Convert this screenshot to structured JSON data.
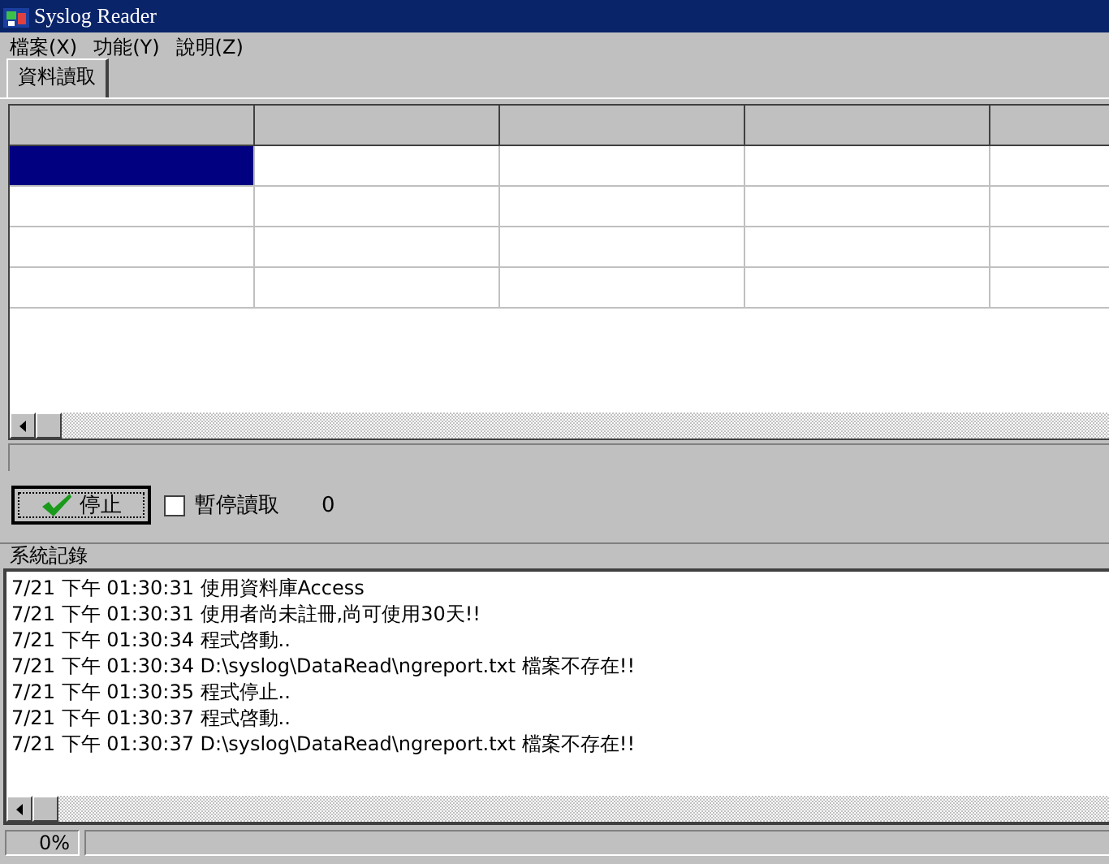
{
  "window": {
    "title": "Syslog Reader"
  },
  "menu": [
    "檔案(X)",
    "功能(Y)",
    "說明(Z)"
  ],
  "tabs": [
    {
      "label": "資料讀取",
      "selected": true
    }
  ],
  "grid": {
    "rows": [
      {
        "selected": true
      },
      {
        "selected": false
      },
      {
        "selected": false
      },
      {
        "selected": false
      }
    ]
  },
  "controls": {
    "stop_button": "停止",
    "pause": {
      "label": "暫停讀取",
      "checked": false
    },
    "count": "0"
  },
  "log": {
    "title": "系統記錄",
    "lines": [
      "7/21 下午 01:30:31 使用資料庫Access",
      "7/21 下午 01:30:31 使用者尚未註冊,尚可使用30天!!",
      "7/21 下午 01:30:34 程式啓動..",
      "7/21 下午 01:30:34 D:\\syslog\\DataRead\\ngreport.txt 檔案不存在!!",
      "7/21 下午 01:30:35 程式停止..",
      "7/21 下午 01:30:37 程式啓動..",
      "7/21 下午 01:30:37 D:\\syslog\\DataRead\\ngreport.txt 檔案不存在!!"
    ]
  },
  "status_bar": {
    "progress": "0%"
  }
}
